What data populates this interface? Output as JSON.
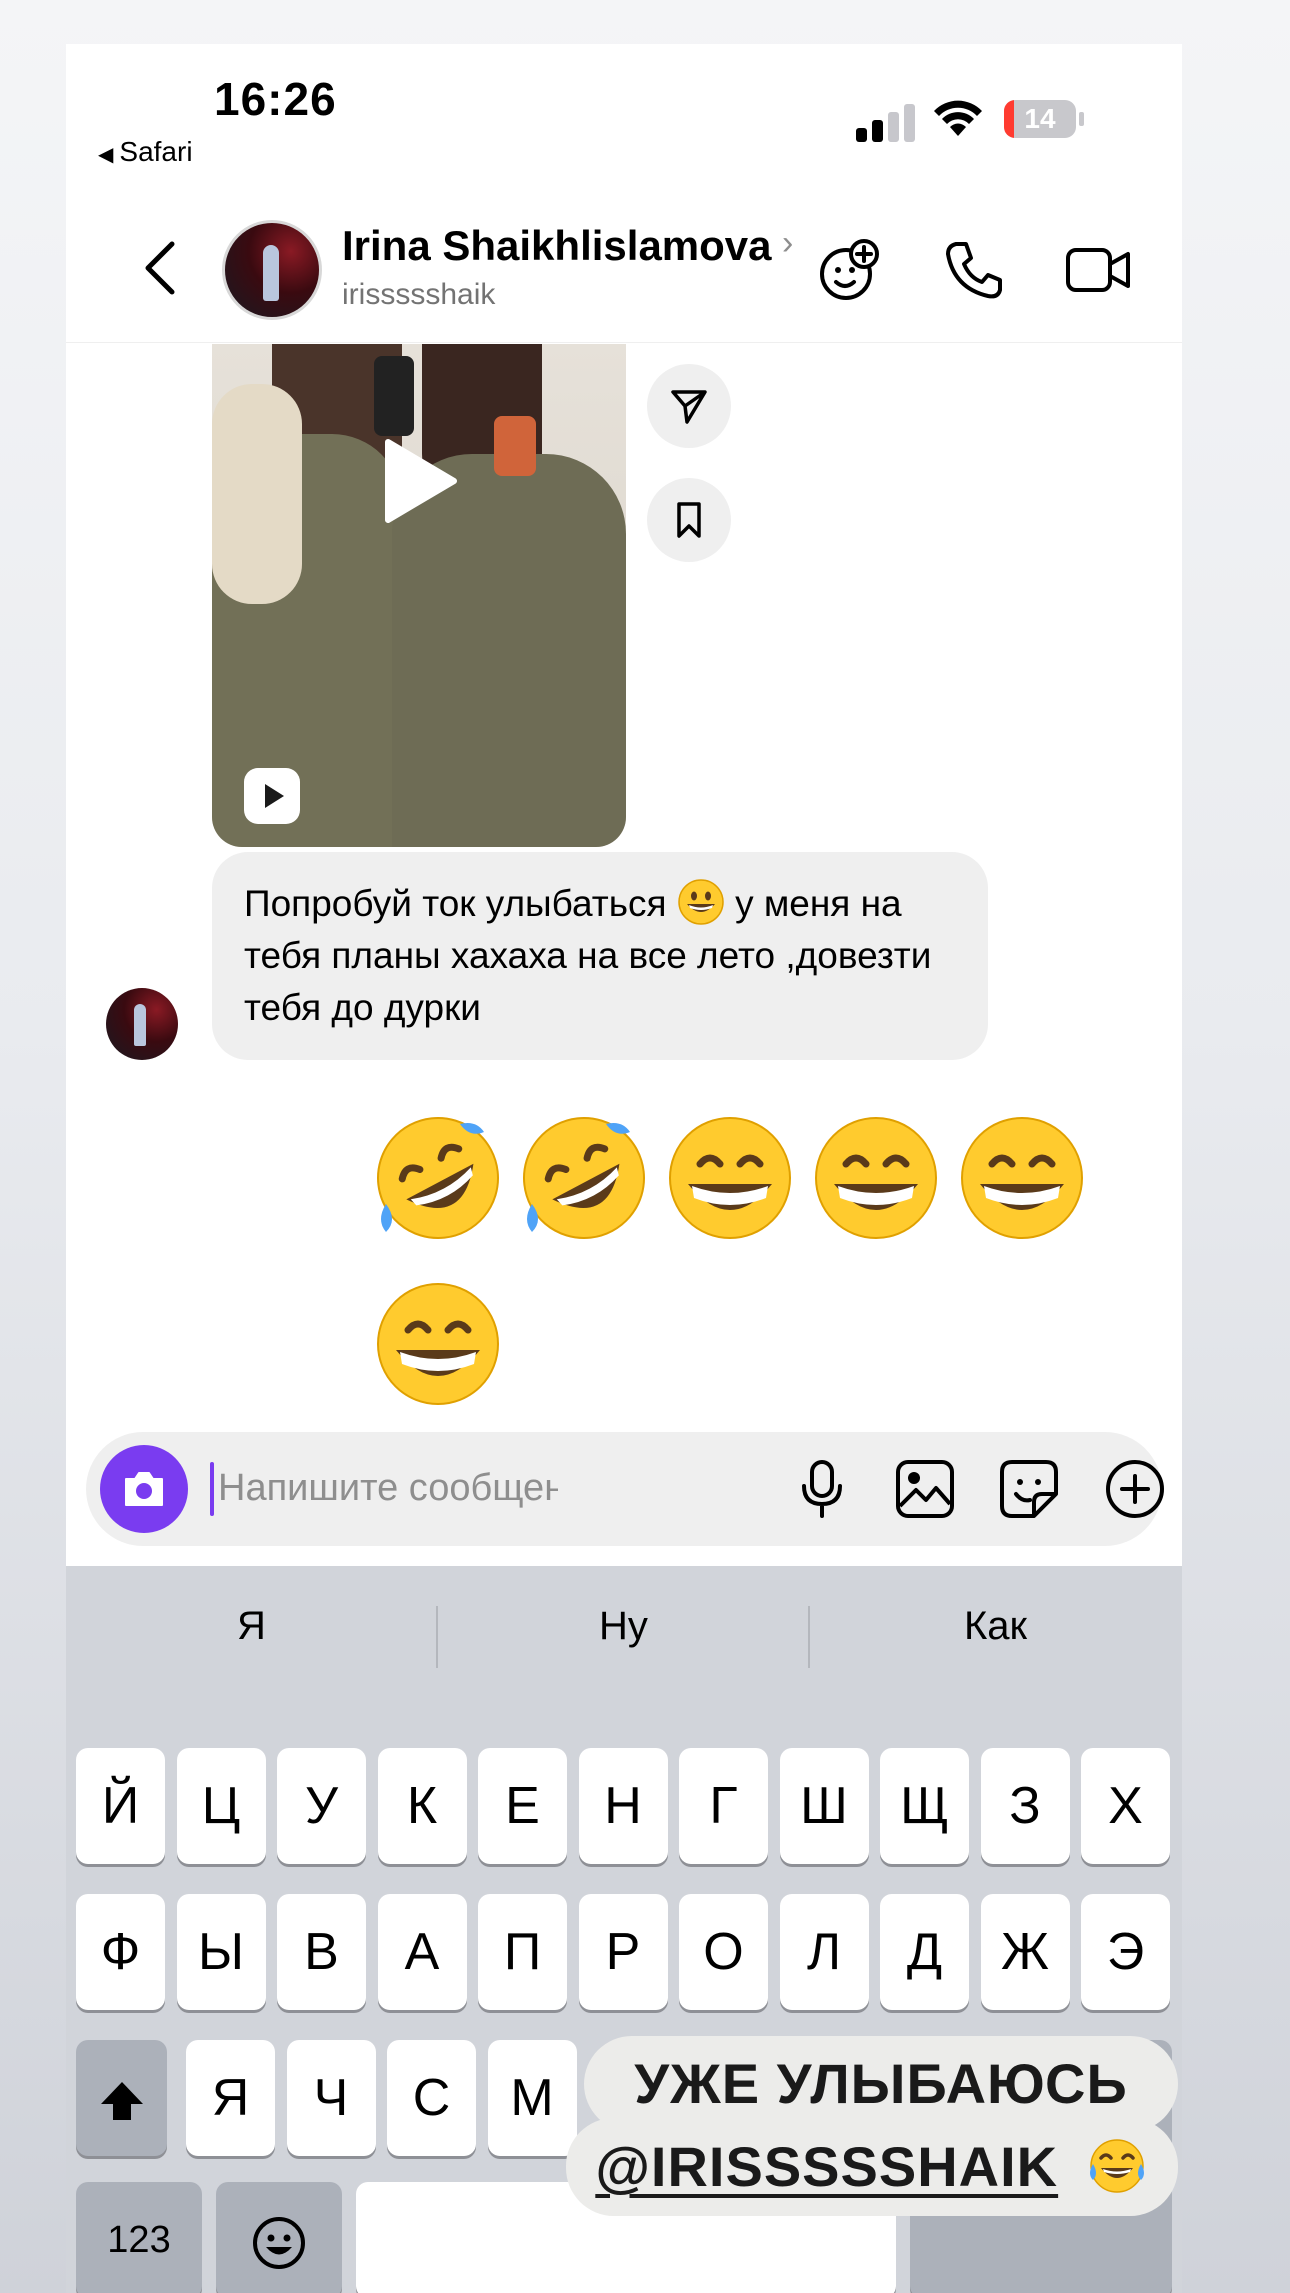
{
  "status_bar": {
    "time": "16:26",
    "back_app": "Safari",
    "battery": "14"
  },
  "header": {
    "name": "Irina Shaikhlislamova",
    "handle": "irissssshaik",
    "icons": [
      "back-chevron-icon",
      "avatar-sticker-icon",
      "phone-icon",
      "video-camera-icon"
    ]
  },
  "thread": {
    "message_parts": [
      "Попробуй ток улыбаться",
      "у меня на тебя планы хахаха на все лето ,довезти тебя до дурки"
    ],
    "sent_emojis": [
      "rolling-on-floor-laughing",
      "rolling-on-floor-laughing",
      "grinning-face-with-smiling-eyes",
      "grinning-face-with-smiling-eyes",
      "grinning-face-with-smiling-eyes",
      "grinning-face-with-smiling-eyes"
    ]
  },
  "composer": {
    "placeholder": "Напишите сообщение..."
  },
  "keyboard": {
    "suggestions": [
      "Я",
      "Ну",
      "Как"
    ],
    "row1": [
      "Й",
      "Ц",
      "У",
      "К",
      "Е",
      "Н",
      "Г",
      "Ш",
      "Щ",
      "З",
      "Х"
    ],
    "row2": [
      "Ф",
      "Ы",
      "В",
      "А",
      "П",
      "Р",
      "О",
      "Л",
      "Д",
      "Ж",
      "Э"
    ],
    "row3": [
      "Я",
      "Ч",
      "С",
      "М"
    ],
    "numbers_key": "123"
  },
  "overlay": {
    "line1": "УЖЕ УЛЫБАЮСЬ",
    "mention": "@IRISSSSSHAIK"
  },
  "colors": {
    "accent": "#7a3cf0",
    "battery_low": "#ff3b30"
  }
}
